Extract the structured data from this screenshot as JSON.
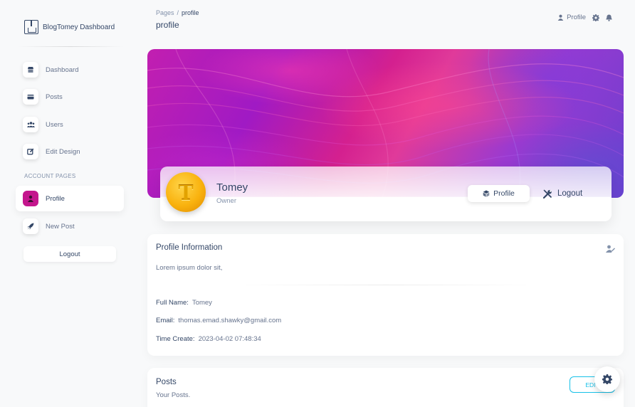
{
  "brand": {
    "name": "BlogTomey Dashboard",
    "logo": "dashboard-logo-icon"
  },
  "sidebar": {
    "items": [
      {
        "label": "Dashboard",
        "icon": "shop-icon"
      },
      {
        "label": "Posts",
        "icon": "credit-card-icon"
      },
      {
        "label": "Users",
        "icon": "users-icon"
      },
      {
        "label": "Edit Design",
        "icon": "edit-icon"
      }
    ],
    "section_title": "ACCOUNT PAGES",
    "account_items": [
      {
        "label": "Profile",
        "icon": "user-icon",
        "active": true
      },
      {
        "label": "New Post",
        "icon": "rocket-icon"
      }
    ],
    "logout_label": "Logout"
  },
  "breadcrumb": {
    "parent": "Pages",
    "separator": "/",
    "current": "profile"
  },
  "page_title": "profile",
  "topnav": {
    "profile_label": "Profile"
  },
  "profile": {
    "avatar_letter": "T",
    "name": "Tomey",
    "role": "Owner",
    "profile_button": "Profile",
    "logout_button": "Logout"
  },
  "info": {
    "title": "Profile Information",
    "description": "Lorem ipsum dolor sit,",
    "rows": [
      {
        "label": "Full Name:",
        "value": "Tomey"
      },
      {
        "label": "Email:",
        "value": "thomas.emad.shawky@gmail.com"
      },
      {
        "label": "Time Create:",
        "value": "2023-04-02 07:48:34"
      }
    ]
  },
  "posts": {
    "title": "Posts",
    "subtitle": "Your Posts.",
    "edit_label": "EDIT"
  },
  "colors": {
    "accent": "#c4168d",
    "info": "#17c1e8",
    "text": "#344767",
    "muted": "#67748e"
  }
}
